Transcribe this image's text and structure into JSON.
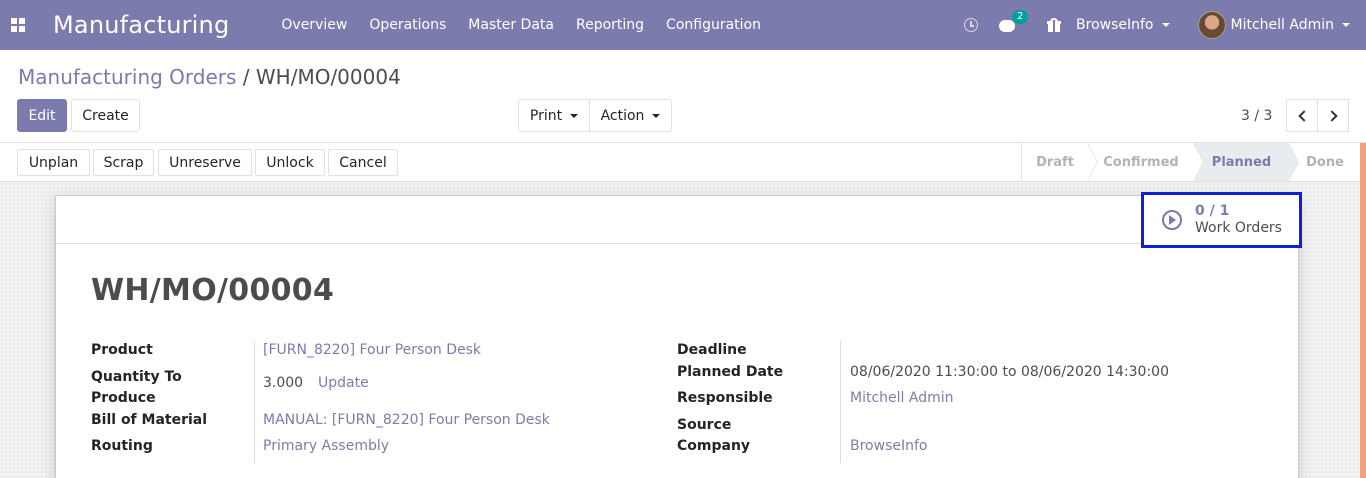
{
  "navbar": {
    "app_name": "Manufacturing",
    "menu": [
      "Overview",
      "Operations",
      "Master Data",
      "Reporting",
      "Configuration"
    ],
    "chat_badge": "2",
    "company": "BrowseInfo",
    "user": "Mitchell Admin"
  },
  "control": {
    "breadcrumb_parent": "Manufacturing Orders",
    "breadcrumb_sep": " / ",
    "breadcrumb_current": "WH/MO/00004",
    "edit_label": "Edit",
    "create_label": "Create",
    "print_label": "Print",
    "action_label": "Action",
    "pager": "3 / 3"
  },
  "statusbar": {
    "buttons": [
      "Unplan",
      "Scrap",
      "Unreserve",
      "Unlock",
      "Cancel"
    ],
    "stages": [
      "Draft",
      "Confirmed",
      "Planned",
      "Done"
    ],
    "active_stage": "Planned"
  },
  "sheet": {
    "work_orders_count": "0 / 1",
    "work_orders_label": "Work Orders",
    "title": "WH/MO/00004",
    "left": {
      "product_label": "Product",
      "product_value": "[FURN_8220] Four Person Desk",
      "qty_label_1": "Quantity To",
      "qty_label_2": "Produce",
      "qty_value": "3.000",
      "qty_update": "Update",
      "bom_label": "Bill of Material",
      "bom_value": "MANUAL: [FURN_8220] Four Person Desk",
      "routing_label": "Routing",
      "routing_value": "Primary Assembly"
    },
    "right": {
      "deadline_label": "Deadline",
      "planned_label": "Planned Date",
      "planned_value": "08/06/2020 11:30:00 to 08/06/2020 14:30:00",
      "responsible_label": "Responsible",
      "responsible_value": "Mitchell Admin",
      "source_label": "Source",
      "company_label": "Company",
      "company_value": "BrowseInfo"
    }
  },
  "colors": {
    "brand": "#7c7bad",
    "highlight_border": "#0f1fd6",
    "badge": "#00a09d"
  }
}
